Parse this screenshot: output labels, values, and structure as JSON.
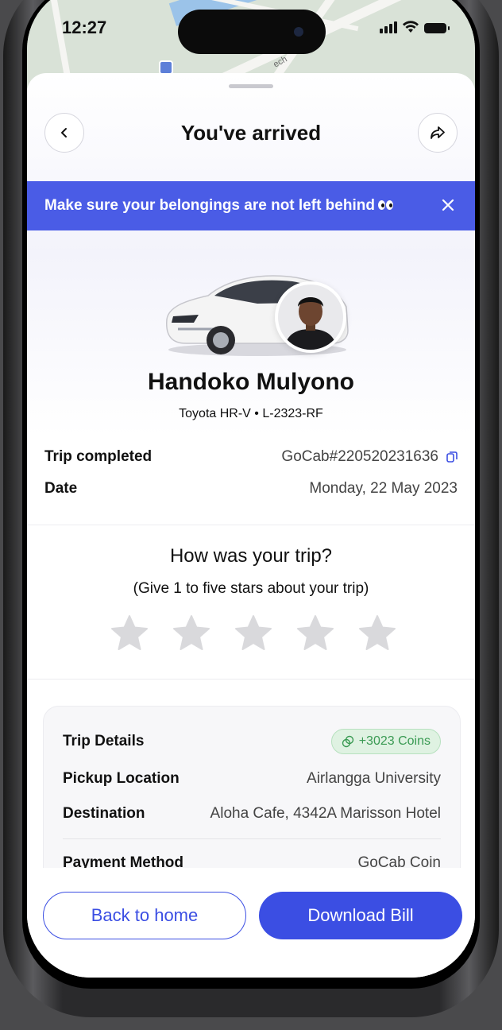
{
  "status_bar": {
    "time": "12:27"
  },
  "header": {
    "title": "You've arrived"
  },
  "banner": {
    "message": "Make sure your belongings are not left behind"
  },
  "driver": {
    "name": "Handoko Mulyono",
    "car_info": "Toyota HR-V • L-2323-RF"
  },
  "trip": {
    "completed_label": "Trip completed",
    "booking_id": "GoCab#220520231636",
    "date_label": "Date",
    "date_value": "Monday, 22 May 2023"
  },
  "rating": {
    "question": "How was your trip?",
    "hint": "(Give 1 to five stars about your trip)",
    "stars_total": 5,
    "stars_selected": 0
  },
  "details": {
    "title": "Trip Details",
    "coins_badge": "+3023 Coins",
    "pickup_label": "Pickup Location",
    "pickup_value": "Airlangga University",
    "destination_label": "Destination",
    "destination_value": "Aloha Cafe, 4342A Marisson Hotel",
    "payment_label": "Payment Method",
    "payment_value": "GoCab Coin"
  },
  "actions": {
    "back_home": "Back to home",
    "download_bill": "Download Bill"
  },
  "colors": {
    "accent": "#3b4ee3",
    "banner": "#4a5ce6",
    "coins_green": "#3a9a53"
  },
  "icons": [
    "chevron-left-icon",
    "share-icon",
    "close-icon",
    "copy-icon",
    "star-icon",
    "coin-link-icon"
  ]
}
